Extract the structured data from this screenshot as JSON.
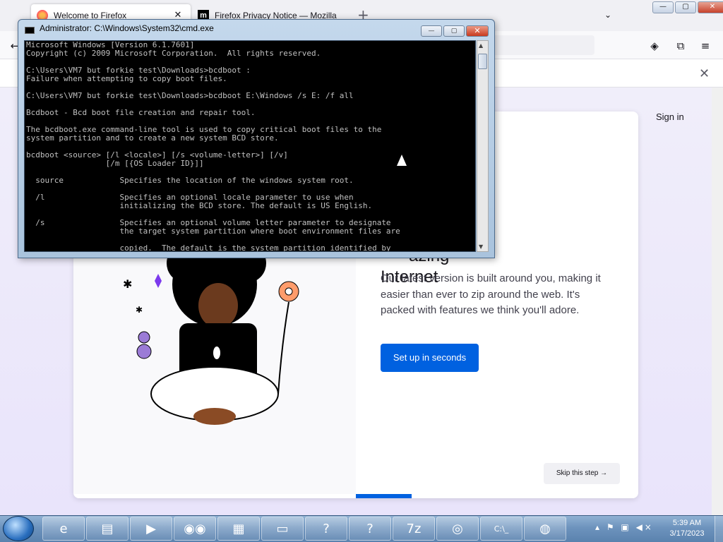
{
  "firefox": {
    "tabs": [
      {
        "title": "Welcome to Firefox"
      },
      {
        "title": "Firefox Privacy Notice — Mozilla"
      }
    ],
    "new_tab": "+",
    "tab_list": "⌄",
    "window_buttons": {
      "minimize": "—",
      "maximize": "▢",
      "close": "✕"
    },
    "nav": {
      "back": "←",
      "pocket": "◈",
      "extensions": "⧉",
      "menu": "≡"
    },
    "notification_close": "✕",
    "sign_in": "Sign in",
    "welcome": {
      "headline": "azing\nInternet",
      "body": "Our latest version is built around you, making it easier than ever to zip around the web. It's packed with features we think you'll adore.",
      "setup_button": "Set up in seconds",
      "skip_button": "Skip this step →"
    },
    "progress_fraction": 0.1,
    "accent_color": "#0061e0"
  },
  "cmd": {
    "title": "Administrator: C:\\Windows\\System32\\cmd.exe",
    "buttons": {
      "minimize": "—",
      "maximize": "▢",
      "close": "✕"
    },
    "scroll_up": "▲",
    "scroll_down": "▼",
    "lines": [
      "Microsoft Windows [Version 6.1.7601]",
      "Copyright (c) 2009 Microsoft Corporation.  All rights reserved.",
      "",
      "C:\\Users\\VM7 but forkie test\\Downloads>bcdboot :",
      "Failure when attempting to copy boot files.",
      "",
      "C:\\Users\\VM7 but forkie test\\Downloads>bcdboot E:\\Windows /s E: /f all",
      "",
      "Bcdboot - Bcd boot file creation and repair tool.",
      "",
      "The bcdboot.exe command-line tool is used to copy critical boot files to the",
      "system partition and to create a new system BCD store.",
      "",
      "bcdboot <source> [/l <locale>] [/s <volume-letter>] [/v]",
      "                 [/m [{OS Loader ID}]]",
      "",
      "  source            Specifies the location of the windows system root.",
      "",
      "  /l                Specifies an optional locale parameter to use when",
      "                    initializing the BCD store. The default is US English.",
      "",
      "  /s                Specifies an optional volume letter parameter to designate",
      "                    the target system partition where boot environment files are",
      "",
      "                    copied.  The default is the system partition identified by"
    ]
  },
  "taskbar": {
    "items": [
      {
        "name": "ie",
        "glyph": "e"
      },
      {
        "name": "explorer",
        "glyph": "▤"
      },
      {
        "name": "media-player",
        "glyph": "▶"
      },
      {
        "name": "eyes",
        "glyph": "◉◉"
      },
      {
        "name": "control-panel",
        "glyph": "▦"
      },
      {
        "name": "toolbox",
        "glyph": "▭"
      },
      {
        "name": "help1",
        "glyph": "?"
      },
      {
        "name": "help2",
        "glyph": "?"
      },
      {
        "name": "7zip",
        "glyph": "7z"
      },
      {
        "name": "disc",
        "glyph": "◎"
      },
      {
        "name": "cmd",
        "glyph": "C:\\_"
      },
      {
        "name": "firefox",
        "glyph": "◍"
      }
    ],
    "tray": "▴ ⚑ ▣ ◀×",
    "time": "5:39 AM",
    "date": "3/17/2023"
  }
}
